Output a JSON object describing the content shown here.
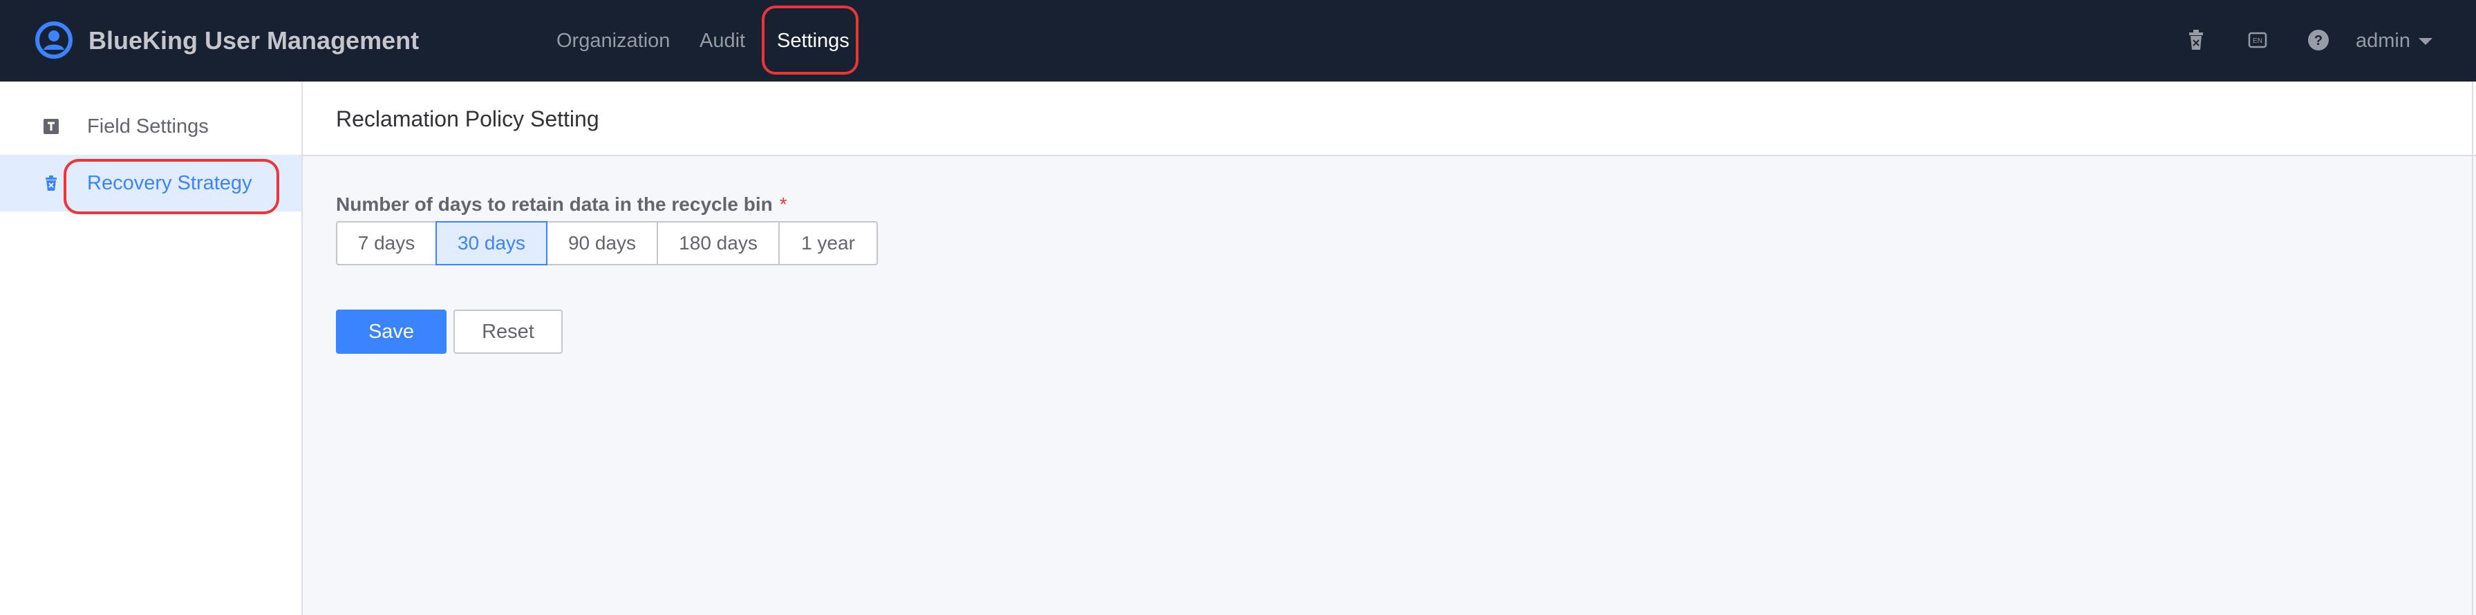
{
  "header": {
    "app_title": "BlueKing User Management",
    "nav": [
      {
        "label": "Organization",
        "active": false
      },
      {
        "label": "Audit",
        "active": false
      },
      {
        "label": "Settings",
        "active": true
      }
    ],
    "icons": [
      "recycle-bin-icon",
      "language-icon",
      "help-icon"
    ],
    "user": "admin"
  },
  "sidebar": {
    "items": [
      {
        "label": "Field Settings",
        "icon": "text-field-icon",
        "active": false
      },
      {
        "label": "Recovery Strategy",
        "icon": "recycle-bin-icon",
        "active": true
      }
    ]
  },
  "main": {
    "title": "Reclamation Policy Setting",
    "retention": {
      "label": "Number of days to retain data in the recycle bin",
      "required_mark": "*",
      "options": [
        "7 days",
        "30 days",
        "90 days",
        "180 days",
        "1 year"
      ],
      "selected": "30 days"
    },
    "buttons": {
      "save": "Save",
      "reset": "Reset"
    }
  },
  "colors": {
    "topbar_bg": "#182132",
    "accent": "#3a84ff",
    "highlight": "#ea3636",
    "page_bg": "#f5f7fa"
  }
}
